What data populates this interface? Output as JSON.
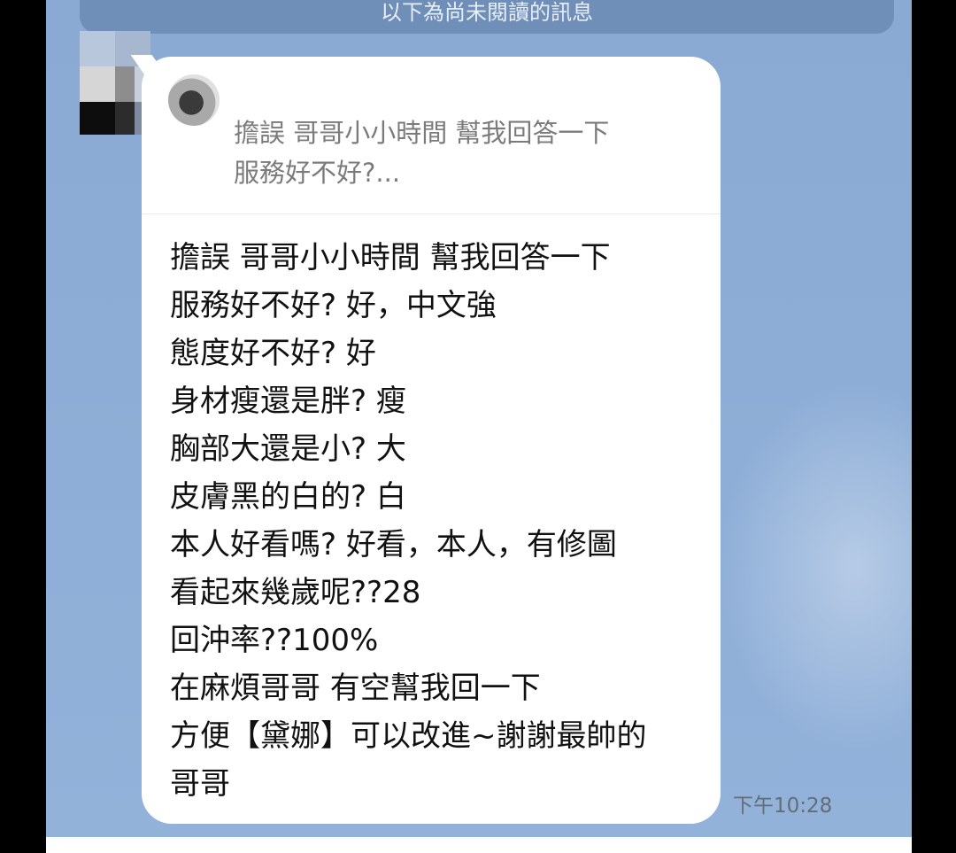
{
  "banner": {
    "label": "以下為尚未閱讀的訊息"
  },
  "message": {
    "quote": {
      "sender_name": "",
      "preview_lines": [
        "擔誤  哥哥小小時間  幫我回答一下",
        "服務好不好?..."
      ]
    },
    "lines": [
      "擔誤  哥哥小小時間  幫我回答一下",
      "服務好不好? 好，中文強",
      "態度好不好? 好",
      "身材瘦還是胖? 瘦",
      "胸部大還是小? 大",
      "皮膚黑的白的? 白",
      "本人好看嗎? 好看，本人，有修圖",
      "看起來幾歲呢??28",
      "回沖率??100%",
      "在麻煩哥哥  有空幫我回一下",
      "方便【黛娜】可以改進~謝謝最帥的",
      "哥哥"
    ],
    "time": "下午10:28"
  },
  "colors": {
    "chat_background": "#8aa9d3",
    "bubble": "#ffffff",
    "banner": "#6f8fb8",
    "side_bars": "#000000"
  }
}
